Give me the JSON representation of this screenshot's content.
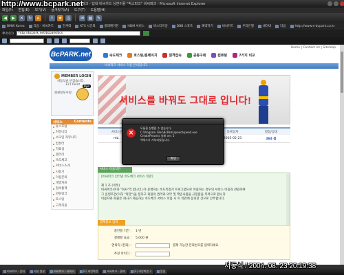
{
  "watermark_top": "http://www.bcpark.net",
  "watermark_bottom": "서동식 / 2004. 08. 23 20:19:38",
  "window": {
    "title": "비씨파크 - 답네 비씨카드 상한이용 \"박스파크\" 비씨파크 - Microsoft Internet Explorer"
  },
  "menubar": [
    "파일(F)",
    "편집(E)",
    "보기(V)",
    "즐겨찾기(A)",
    "도구(T)",
    "도움말(H)"
  ],
  "links": [
    "BMW Korea",
    "다음 - 비씨카드",
    "한겨레",
    "KTX 시간표",
    "올레매거진",
    "HDM 서비스",
    "버스터미널",
    "DBB 스포츠",
    "예약하기",
    "비씨카드",
    "우리은행",
    "네이버",
    "다음",
    "http://www.e-bcpark.co.kr"
  ],
  "address": {
    "label": "주소(D)",
    "value": "http://bcpark.net/bcpark/bcs"
  },
  "site": {
    "logo": "BcPARK.net",
    "toplinks": "Home | Contact Us | Sitemap",
    "gnb": [
      "속도체크",
      "호스팅/홈페이지",
      "원격접속",
      "공동구매",
      "컴퓨팅",
      "7가지 비교"
    ],
    "bluebar": "비씨파크 서비스 이용 안내입니다."
  },
  "login": {
    "title": "MEMBER LOGIN",
    "greeting": "서동식님 반갑습니다.",
    "points": "121 Point",
    "link": "회원정보수정",
    "mascot_text": "Bye"
  },
  "sidebar": {
    "head_left": "서비스",
    "head_right": "Contents",
    "items": [
      "뉴스포털",
      "커뮤니티",
      "소모임 커뮤니티",
      "컴퓨터",
      "자료실",
      "갤러리",
      "속도체크",
      "서비스소개",
      "사용기",
      "이용문의",
      "개발자료",
      "접속통계",
      "관련링크",
      "토스팅",
      "고객지원"
    ]
  },
  "banner": {
    "slogan": "서비스를 바꿔도 그대로 입니다!"
  },
  "table": {
    "headers": [
      "서비스명",
      "접속서버",
      "주간 체크",
      "등록일자",
      "평점/상태"
    ],
    "row": [
      "mb..",
      "",
      "",
      "2005-05-23",
      "384 점"
    ]
  },
  "service": {
    "tab": "서비스 이용약관",
    "title": "[비씨파크 인터넷 속도체크 서비스 약관]",
    "lines": [
      "제 1 조 (목적)",
      "",
      "비씨파크(이하 \"회사\"라 합니다.)가 운영하는 속도측정기 프로그램으로 이용하는 경우의 서비스 이용과 관련하여",
      "그 운영조건(이하 \"약관\")을 정하고 회원의 권리와 의무 및 책임사항을 규정함을 목적으로 합니다.",
      "이용자와 회원은 회사가 제공하는 속도체크 서비스 이용 시 이 약관에 동의한 것으로 간주합니다."
    ]
  },
  "payment": {
    "tab": "결제정보 입력",
    "rows": [
      {
        "label": "충전할 기간 :",
        "value": "1 년"
      },
      {
        "label": "결제할 요금 :",
        "value": "5,000 원"
      },
      {
        "label": "연락처 (전화) :",
        "value": "",
        "note": "결제 가능한 전화번호를 입력하세요."
      },
      {
        "label": "추천 아이디 :",
        "value": ""
      }
    ]
  },
  "dialog": {
    "lines": [
      "모듈을 실행할 수 없습니다.",
      "C:\\Program Files\\BcPark\\speed\\speed.exe",
      "",
      "CreateProcess 실패 코드 5",
      "액세스가 거부되었습니다."
    ],
    "ok": "확인"
  },
  "taskbar": [
    "비씨파크 - 답내",
    "사본 원본",
    "비씨파크 - 서비스",
    "[E] 바탕화면",
    "비씨파크 - 결제",
    "[E] 바탕화면 2",
    "알림"
  ]
}
